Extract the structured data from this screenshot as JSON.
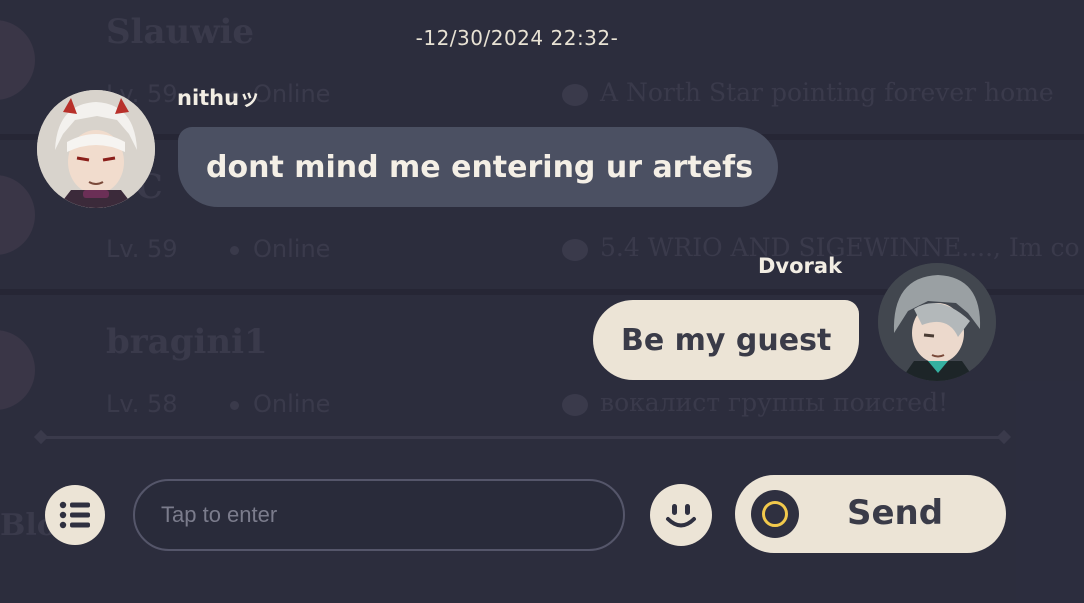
{
  "background_list": {
    "rows": [
      {
        "name": "Slauwie",
        "level": "Lv. 59",
        "status": "Online",
        "signature": "A North Star pointing forever home"
      },
      {
        "name": "OC",
        "level": "Lv. 59",
        "status": "Online",
        "signature": "5.4 WRIO AND SIGEWINNE...., Im co"
      },
      {
        "name": "bragini1",
        "level": "Lv. 58",
        "status": "Online",
        "signature": "вокалист группы поисred!"
      }
    ],
    "bottom_tag": "Blo   st"
  },
  "chat": {
    "timestamp": "-12/30/2024 22:32-",
    "messages": [
      {
        "sender": "nithuッ",
        "text": "dont mind me entering ur artefs",
        "side": "left"
      },
      {
        "sender": "Dvorak",
        "text": "Be my guest",
        "side": "right"
      }
    ]
  },
  "input_bar": {
    "placeholder": "Tap to enter",
    "send_label": "Send"
  },
  "colors": {
    "own_bubble": "#ece4d6",
    "other_bubble": "#4b5062",
    "send_ring_accent": "#f2c94c"
  },
  "icons": [
    "list-icon",
    "emoji-icon",
    "send-ring-icon"
  ]
}
